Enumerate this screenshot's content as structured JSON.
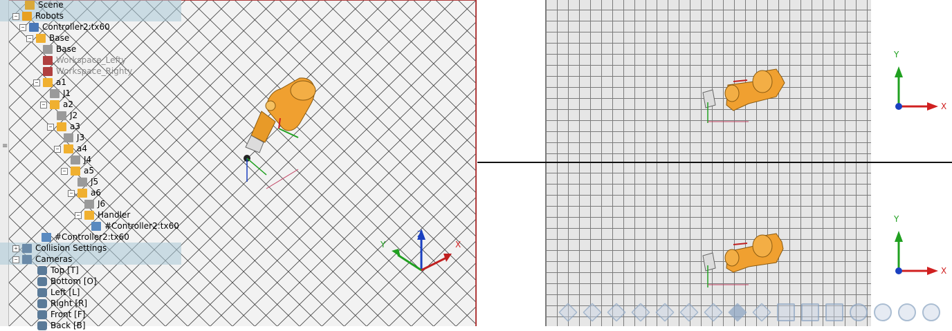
{
  "scene_tree": {
    "items": [
      {
        "label": "Scene",
        "icon": "scene-icon",
        "expander": "",
        "selected": true,
        "dimmed": false
      },
      {
        "label": "Robots",
        "icon": "robot-icon",
        "expander": "−",
        "selected": true,
        "dimmed": false
      },
      {
        "label": "Controller2:tx60",
        "icon": "controller-icon",
        "expander": "−",
        "selected": false,
        "dimmed": false
      },
      {
        "label": "Base",
        "icon": "frame-icon",
        "expander": "−",
        "selected": false,
        "dimmed": false
      },
      {
        "label": "Base",
        "icon": "cube-icon",
        "expander": "",
        "selected": false,
        "dimmed": false
      },
      {
        "label": "Workspace_Lefty",
        "icon": "workspace-icon",
        "expander": "",
        "selected": false,
        "dimmed": true
      },
      {
        "label": "Workspace_Righty",
        "icon": "workspace-icon",
        "expander": "",
        "selected": false,
        "dimmed": true
      },
      {
        "label": "a1",
        "icon": "frame-icon",
        "expander": "−",
        "selected": false,
        "dimmed": false
      },
      {
        "label": "J1",
        "icon": "cube-icon",
        "expander": "",
        "selected": false,
        "dimmed": false
      },
      {
        "label": "a2",
        "icon": "frame-icon",
        "expander": "−",
        "selected": false,
        "dimmed": false
      },
      {
        "label": "J2",
        "icon": "cube-icon",
        "expander": "",
        "selected": false,
        "dimmed": false
      },
      {
        "label": "a3",
        "icon": "frame-icon",
        "expander": "−",
        "selected": false,
        "dimmed": false
      },
      {
        "label": "J3",
        "icon": "cube-icon",
        "expander": "",
        "selected": false,
        "dimmed": false
      },
      {
        "label": "a4",
        "icon": "frame-icon",
        "expander": "−",
        "selected": false,
        "dimmed": false
      },
      {
        "label": "J4",
        "icon": "cube-icon",
        "expander": "",
        "selected": false,
        "dimmed": false
      },
      {
        "label": "a5",
        "icon": "frame-icon",
        "expander": "−",
        "selected": false,
        "dimmed": false
      },
      {
        "label": "J5",
        "icon": "cube-icon",
        "expander": "",
        "selected": false,
        "dimmed": false
      },
      {
        "label": "a6",
        "icon": "frame-icon",
        "expander": "−",
        "selected": false,
        "dimmed": false
      },
      {
        "label": "J6",
        "icon": "cube-icon",
        "expander": "",
        "selected": false,
        "dimmed": false
      },
      {
        "label": "Handler",
        "icon": "frame-icon",
        "expander": "−",
        "selected": false,
        "dimmed": false
      },
      {
        "label": "#Controller2:tx60",
        "icon": "link-icon",
        "expander": "",
        "selected": false,
        "dimmed": false
      },
      {
        "label": "#Controller2:tx60",
        "icon": "link-icon",
        "expander": "",
        "selected": false,
        "dimmed": false
      },
      {
        "label": "Collision Settings",
        "icon": "collision-icon",
        "expander": "+",
        "selected": true,
        "dimmed": false
      },
      {
        "label": "Cameras",
        "icon": "camera-group-icon",
        "expander": "−",
        "selected": true,
        "dimmed": false
      },
      {
        "label": "Top [T]",
        "icon": "camera-icon",
        "expander": "",
        "selected": false,
        "dimmed": false
      },
      {
        "label": "Bottom [O]",
        "icon": "camera-icon",
        "expander": "",
        "selected": false,
        "dimmed": false
      },
      {
        "label": "Left [L]",
        "icon": "camera-icon",
        "expander": "",
        "selected": false,
        "dimmed": false
      },
      {
        "label": "Right [R]",
        "icon": "camera-icon",
        "expander": "",
        "selected": false,
        "dimmed": false
      },
      {
        "label": "Front [F]",
        "icon": "camera-icon",
        "expander": "",
        "selected": false,
        "dimmed": false
      },
      {
        "label": "Back [B]",
        "icon": "camera-icon",
        "expander": "",
        "selected": false,
        "dimmed": false
      }
    ]
  },
  "main_view": {
    "axis_labels": {
      "x": "X",
      "y": "Y",
      "z": "Z"
    }
  },
  "top_view": {
    "axis_labels": {
      "x": "X",
      "y": "Y"
    }
  },
  "bottom_view": {
    "axis_labels": {
      "x": "X",
      "y": "Y"
    }
  },
  "colors": {
    "robot": "#f0a030",
    "axis_x": "#d02020",
    "axis_y": "#20a020",
    "axis_z": "#1a40c0",
    "viewport_border": "#b03a3a",
    "selection": "#aac8d7"
  },
  "toolbar": {
    "buttons": [
      {
        "name": "view-iso-1-icon"
      },
      {
        "name": "view-iso-2-icon"
      },
      {
        "name": "view-iso-3-icon"
      },
      {
        "name": "view-iso-4-icon"
      },
      {
        "name": "view-iso-5-icon"
      },
      {
        "name": "view-iso-6-icon"
      },
      {
        "name": "view-iso-7-icon"
      },
      {
        "name": "solid-cube-icon"
      },
      {
        "name": "wire-cube-icon"
      },
      {
        "name": "measure-icon"
      },
      {
        "name": "fit-icon"
      },
      {
        "name": "select-icon"
      },
      {
        "name": "pan-hand-icon"
      },
      {
        "name": "rotate-icon"
      },
      {
        "name": "zoom-icon"
      },
      {
        "name": "move-icon"
      }
    ]
  }
}
